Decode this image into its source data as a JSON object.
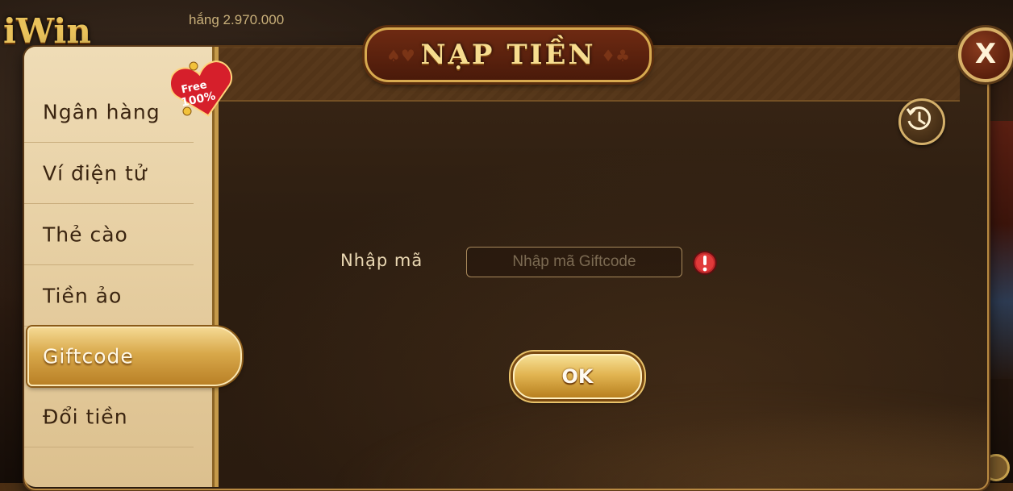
{
  "background": {
    "logo_text": "iWin",
    "winnings_text": "hắng 2.970.000"
  },
  "dialog": {
    "title": "NẠP TIỀN",
    "close_label": "X"
  },
  "sidebar": {
    "items": [
      {
        "label": "Ngân hàng",
        "active": false
      },
      {
        "label": "Ví điện tử",
        "active": false
      },
      {
        "label": "Thẻ cào",
        "active": false
      },
      {
        "label": "Tiền ảo",
        "active": false
      },
      {
        "label": "Giftcode",
        "active": true
      },
      {
        "label": "Đổi tiền",
        "active": false
      }
    ],
    "badge": {
      "line1": "Free",
      "line2": "100%"
    }
  },
  "form": {
    "code_label": "Nhập mã",
    "code_input": {
      "value": "",
      "placeholder": "Nhập mã Giftcode"
    },
    "submit_label": "OK"
  },
  "icons": {
    "history": "history-icon",
    "warning": "warning-icon",
    "close": "close-icon"
  },
  "colors": {
    "accent_gold": "#d7a94f",
    "panel_dark": "#2d1e11",
    "sidebar_cream": "#e6cea1",
    "warning_red": "#c0282a"
  }
}
